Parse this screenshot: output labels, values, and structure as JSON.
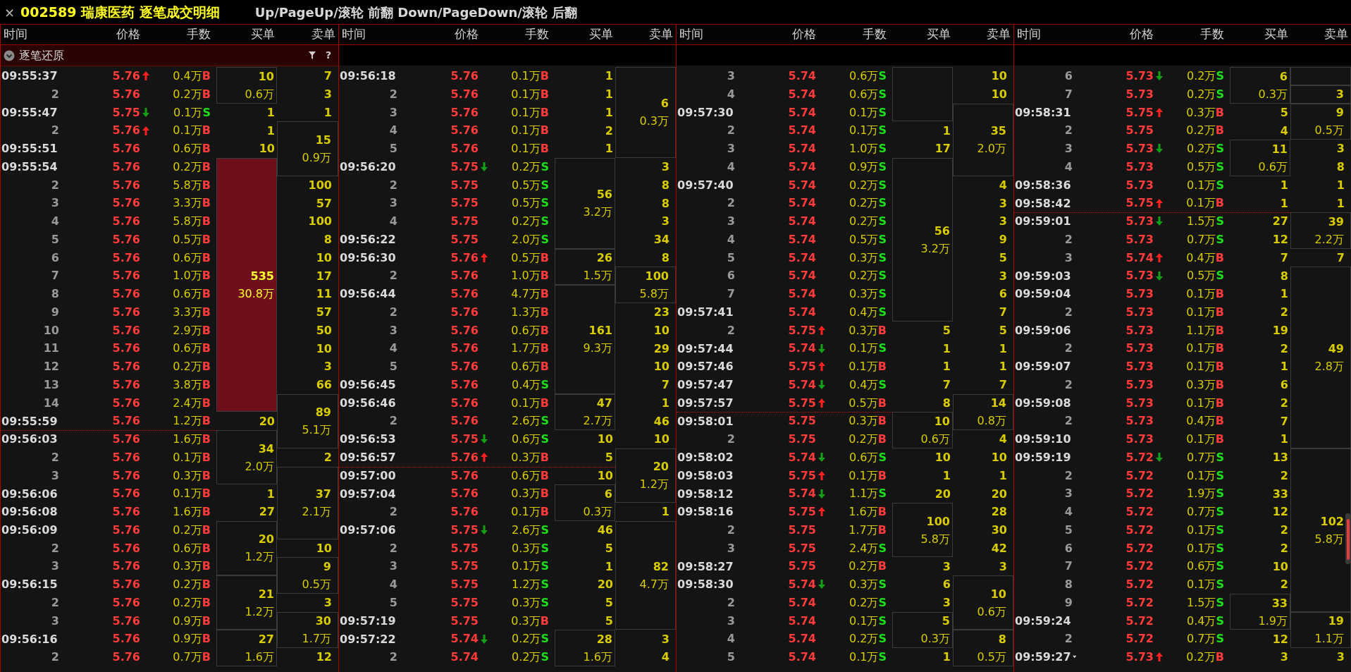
{
  "title": {
    "close": "×",
    "stock": "002589 瑞康医药 逐笔成交明细",
    "hint": "Up/PageUp/滚轮 前翻 Down/PageDown/滚轮 后翻"
  },
  "panels": [
    {
      "headers": [
        "时间",
        "价格",
        "手数",
        "买单",
        "卖单"
      ],
      "toolbar": {
        "label": "逐笔还原",
        "help": "?"
      },
      "rows": [
        {
          "time": "09:55:37",
          "price": "5.76",
          "uptick": true,
          "volume": "0.4万",
          "side": "B",
          "buyer": true,
          "buy": {
            "count": "10",
            "amount": "0.6万",
            "boxed": true
          },
          "sell": {
            "count": "7",
            "boxed": false
          }
        },
        {
          "seq": "2",
          "price": "5.76",
          "volume": "0.2万",
          "side": "B",
          "buyer": true,
          "sell": {
            "count": "3",
            "boxed": false
          }
        },
        {
          "time": "09:55:47",
          "price": "5.75",
          "downtick": true,
          "volume": "0.1万",
          "side": "S",
          "buyer": false,
          "buy": {
            "count": "1",
            "boxed": false
          },
          "sell": {
            "count": "1",
            "boxed": false
          }
        },
        {
          "seq": "2",
          "price": "5.76",
          "uptick": true,
          "volume": "0.1万",
          "side": "B",
          "buyer": true,
          "buy": {
            "count": "1",
            "boxed": false
          },
          "sell": {
            "count": "15",
            "amount": "0.9万",
            "boxed": true
          }
        },
        {
          "time": "09:55:51",
          "price": "5.76",
          "volume": "0.6万",
          "side": "B",
          "buyer": true,
          "buy": {
            "count": "10",
            "boxed": false
          }
        },
        {
          "time": "09:55:54",
          "price": "5.76",
          "volume": "0.2万",
          "side": "B",
          "buyer": true,
          "buy": {
            "count": "535",
            "amount": "30.8万",
            "boxed": true,
            "highlight": true
          }
        },
        {
          "seq": "2",
          "price": "5.76",
          "volume": "5.8万",
          "side": "B",
          "buyer": true,
          "sell": {
            "count": "100",
            "boxed": false
          }
        },
        {
          "seq": "3",
          "price": "5.76",
          "volume": "3.3万",
          "side": "B",
          "buyer": true,
          "sell": {
            "count": "57",
            "boxed": false
          }
        },
        {
          "seq": "4",
          "price": "5.76",
          "volume": "5.8万",
          "side": "B",
          "buyer": true,
          "sell": {
            "count": "100",
            "boxed": false
          }
        },
        {
          "seq": "5",
          "price": "5.76",
          "volume": "0.5万",
          "side": "B",
          "buyer": true,
          "sell": {
            "count": "8",
            "boxed": false
          }
        },
        {
          "seq": "6",
          "price": "5.76",
          "volume": "0.6万",
          "side": "B",
          "buyer": true,
          "sell": {
            "count": "10",
            "boxed": false
          }
        },
        {
          "seq": "7",
          "price": "5.76",
          "volume": "1.0万",
          "side": "B",
          "buyer": true,
          "sell": {
            "count": "17",
            "boxed": false
          }
        },
        {
          "seq": "8",
          "price": "5.76",
          "volume": "0.6万",
          "side": "B",
          "buyer": true,
          "sell": {
            "count": "11",
            "boxed": false
          }
        },
        {
          "seq": "9",
          "price": "5.76",
          "volume": "3.3万",
          "side": "B",
          "buyer": true,
          "sell": {
            "count": "57",
            "boxed": false
          }
        },
        {
          "seq": "10",
          "price": "5.76",
          "volume": "2.9万",
          "side": "B",
          "buyer": true,
          "sell": {
            "count": "50",
            "boxed": false
          }
        },
        {
          "seq": "11",
          "price": "5.76",
          "volume": "0.6万",
          "side": "B",
          "buyer": true,
          "sell": {
            "count": "10",
            "boxed": false
          }
        },
        {
          "seq": "12",
          "price": "5.76",
          "volume": "0.2万",
          "side": "B",
          "buyer": true,
          "sell": {
            "count": "3",
            "boxed": false
          }
        },
        {
          "seq": "13",
          "price": "5.76",
          "volume": "3.8万",
          "side": "B",
          "buyer": true,
          "sell": {
            "count": "66",
            "boxed": false
          }
        },
        {
          "seq": "14",
          "price": "5.76",
          "volume": "2.4万",
          "side": "B",
          "buyer": true,
          "sell": {
            "count": "89",
            "amount": "5.1万",
            "boxed": true
          }
        },
        {
          "time": "09:55:59",
          "price": "5.76",
          "volume": "1.2万",
          "side": "B",
          "buyer": true,
          "buy": {
            "count": "20",
            "boxed": false
          }
        },
        {
          "time": "09:56:03",
          "price": "5.76",
          "volume": "1.6万",
          "side": "B",
          "buyer": true,
          "divider_above": true,
          "buy": {
            "count": "34",
            "amount": "2.0万",
            "boxed": true
          }
        },
        {
          "seq": "2",
          "price": "5.76",
          "volume": "0.1万",
          "side": "B",
          "buyer": true,
          "sell": {
            "count": "2",
            "boxed": false
          }
        },
        {
          "seq": "3",
          "price": "5.76",
          "volume": "0.3万",
          "side": "B",
          "buyer": true,
          "sell": {
            "count": "37",
            "amount": "2.1万",
            "boxed": true
          }
        },
        {
          "time": "09:56:06",
          "price": "5.76",
          "volume": "0.1万",
          "side": "B",
          "buyer": true,
          "buy": {
            "count": "1",
            "boxed": false
          }
        },
        {
          "time": "09:56:08",
          "price": "5.76",
          "volume": "1.6万",
          "side": "B",
          "buyer": true,
          "buy": {
            "count": "27",
            "boxed": false
          }
        },
        {
          "time": "09:56:09",
          "price": "5.76",
          "volume": "0.2万",
          "side": "B",
          "buyer": true,
          "buy": {
            "count": "20",
            "amount": "1.2万",
            "boxed": true
          }
        },
        {
          "seq": "2",
          "price": "5.76",
          "volume": "0.6万",
          "side": "B",
          "buyer": true,
          "sell": {
            "count": "10",
            "boxed": false
          }
        },
        {
          "seq": "3",
          "price": "5.76",
          "volume": "0.3万",
          "side": "B",
          "buyer": true,
          "sell": {
            "count": "9",
            "amount": "0.5万",
            "boxed": true
          }
        },
        {
          "time": "09:56:15",
          "price": "5.76",
          "volume": "0.2万",
          "side": "B",
          "buyer": true,
          "buy": {
            "count": "21",
            "amount": "1.2万",
            "boxed": true
          }
        },
        {
          "seq": "2",
          "price": "5.76",
          "volume": "0.2万",
          "side": "B",
          "buyer": true,
          "sell": {
            "count": "3",
            "boxed": false
          }
        },
        {
          "seq": "3",
          "price": "5.76",
          "volume": "0.9万",
          "side": "B",
          "buyer": true,
          "sell": {
            "count": "30",
            "amount": "1.7万",
            "boxed": true
          }
        },
        {
          "time": "09:56:16",
          "price": "5.76",
          "volume": "0.9万",
          "side": "B",
          "buyer": true,
          "buy": {
            "count": "27",
            "amount": "1.6万",
            "boxed": true
          }
        },
        {
          "seq": "2",
          "price": "5.76",
          "volume": "0.7万",
          "side": "B",
          "buyer": true,
          "sell": {
            "count": "12",
            "boxed": false
          }
        }
      ]
    },
    {
      "headers": [
        "时间",
        "价格",
        "手数",
        "买单",
        "卖单"
      ],
      "rows": [
        {
          "time": "09:56:18",
          "price": "5.76",
          "volume": "0.1万",
          "side": "B",
          "buyer": true,
          "buy": {
            "count": "1",
            "boxed": false
          },
          "sell": {
            "count": "6",
            "amount": "0.3万",
            "boxed": true
          }
        },
        {
          "seq": "2",
          "price": "5.76",
          "volume": "0.1万",
          "side": "B",
          "buyer": true,
          "buy": {
            "count": "1",
            "boxed": false
          }
        },
        {
          "seq": "3",
          "price": "5.76",
          "volume": "0.1万",
          "side": "B",
          "buyer": true,
          "buy": {
            "count": "1",
            "boxed": false
          }
        },
        {
          "seq": "4",
          "price": "5.76",
          "volume": "0.1万",
          "side": "B",
          "buyer": true,
          "buy": {
            "count": "2",
            "boxed": false
          }
        },
        {
          "seq": "5",
          "price": "5.76",
          "volume": "0.1万",
          "side": "B",
          "buyer": true,
          "buy": {
            "count": "1",
            "boxed": false
          }
        },
        {
          "time": "09:56:20",
          "price": "5.75",
          "downtick": true,
          "volume": "0.2万",
          "side": "S",
          "buyer": false,
          "buy": {
            "count": "56",
            "amount": "3.2万",
            "boxed": true
          },
          "sell": {
            "count": "3",
            "boxed": false
          }
        },
        {
          "seq": "2",
          "price": "5.75",
          "volume": "0.5万",
          "side": "S",
          "buyer": false,
          "sell": {
            "count": "8",
            "boxed": false
          }
        },
        {
          "seq": "3",
          "price": "5.75",
          "volume": "0.5万",
          "side": "S",
          "buyer": false,
          "sell": {
            "count": "8",
            "boxed": false
          }
        },
        {
          "seq": "4",
          "price": "5.75",
          "volume": "0.2万",
          "side": "S",
          "buyer": false,
          "sell": {
            "count": "3",
            "boxed": false
          }
        },
        {
          "time": "09:56:22",
          "price": "5.75",
          "volume": "2.0万",
          "side": "S",
          "buyer": false,
          "sell": {
            "count": "34",
            "boxed": false
          }
        },
        {
          "time": "09:56:30",
          "price": "5.76",
          "uptick": true,
          "volume": "0.5万",
          "side": "B",
          "buyer": true,
          "buy": {
            "count": "26",
            "amount": "1.5万",
            "boxed": true
          },
          "sell": {
            "count": "8",
            "boxed": false
          }
        },
        {
          "seq": "2",
          "price": "5.76",
          "volume": "1.0万",
          "side": "B",
          "buyer": true,
          "sell": {
            "count": "100",
            "amount": "5.8万",
            "boxed": true
          }
        },
        {
          "time": "09:56:44",
          "price": "5.76",
          "volume": "4.7万",
          "side": "B",
          "buyer": true,
          "buy": {
            "count": "161",
            "amount": "9.3万",
            "boxed": true
          }
        },
        {
          "seq": "2",
          "price": "5.76",
          "volume": "1.3万",
          "side": "B",
          "buyer": true,
          "sell": {
            "count": "23",
            "boxed": false
          }
        },
        {
          "seq": "3",
          "price": "5.76",
          "volume": "0.6万",
          "side": "B",
          "buyer": true,
          "sell": {
            "count": "10",
            "boxed": false
          }
        },
        {
          "seq": "4",
          "price": "5.76",
          "volume": "1.7万",
          "side": "B",
          "buyer": true,
          "sell": {
            "count": "29",
            "boxed": false
          }
        },
        {
          "seq": "5",
          "price": "5.76",
          "volume": "0.6万",
          "side": "B",
          "buyer": true,
          "sell": {
            "count": "10",
            "boxed": false
          }
        },
        {
          "time": "09:56:45",
          "price": "5.76",
          "volume": "0.4万",
          "side": "S",
          "buyer": false,
          "sell": {
            "count": "7",
            "boxed": false
          }
        },
        {
          "time": "09:56:46",
          "price": "5.76",
          "volume": "0.1万",
          "side": "B",
          "buyer": true,
          "buy": {
            "count": "47",
            "amount": "2.7万",
            "boxed": true
          },
          "sell": {
            "count": "1",
            "boxed": false
          }
        },
        {
          "seq": "2",
          "price": "5.76",
          "volume": "2.6万",
          "side": "S",
          "buyer": false,
          "sell": {
            "count": "46",
            "boxed": false
          }
        },
        {
          "time": "09:56:53",
          "price": "5.75",
          "downtick": true,
          "volume": "0.6万",
          "side": "S",
          "buyer": false,
          "buy": {
            "count": "10",
            "boxed": false
          },
          "sell": {
            "count": "10",
            "boxed": false
          }
        },
        {
          "time": "09:56:57",
          "price": "5.76",
          "uptick": true,
          "volume": "0.3万",
          "side": "B",
          "buyer": true,
          "buy": {
            "count": "5",
            "boxed": false
          },
          "sell": {
            "count": "20",
            "amount": "1.2万",
            "boxed": true
          }
        },
        {
          "time": "09:57:00",
          "price": "5.76",
          "volume": "0.6万",
          "side": "B",
          "buyer": true,
          "divider_above": true,
          "buy": {
            "count": "10",
            "boxed": false
          }
        },
        {
          "time": "09:57:04",
          "price": "5.76",
          "volume": "0.3万",
          "side": "B",
          "buyer": true,
          "buy": {
            "count": "6",
            "amount": "0.3万",
            "boxed": true
          }
        },
        {
          "seq": "2",
          "price": "5.76",
          "volume": "0.1万",
          "side": "B",
          "buyer": true,
          "sell": {
            "count": "1",
            "boxed": false
          }
        },
        {
          "time": "09:57:06",
          "price": "5.75",
          "downtick": true,
          "volume": "2.6万",
          "side": "S",
          "buyer": false,
          "buy": {
            "count": "46",
            "boxed": false
          },
          "sell": {
            "count": "82",
            "amount": "4.7万",
            "boxed": true
          }
        },
        {
          "seq": "2",
          "price": "5.75",
          "volume": "0.3万",
          "side": "S",
          "buyer": false,
          "buy": {
            "count": "5",
            "boxed": false
          }
        },
        {
          "seq": "3",
          "price": "5.75",
          "volume": "0.1万",
          "side": "S",
          "buyer": false,
          "buy": {
            "count": "1",
            "boxed": false
          }
        },
        {
          "seq": "4",
          "price": "5.75",
          "volume": "1.2万",
          "side": "S",
          "buyer": false,
          "buy": {
            "count": "20",
            "boxed": false
          }
        },
        {
          "seq": "5",
          "price": "5.75",
          "volume": "0.3万",
          "side": "S",
          "buyer": false,
          "buy": {
            "count": "5",
            "boxed": false
          }
        },
        {
          "time": "09:57:19",
          "price": "5.75",
          "volume": "0.3万",
          "side": "B",
          "buyer": true,
          "buy": {
            "count": "5",
            "boxed": false
          }
        },
        {
          "time": "09:57:22",
          "price": "5.74",
          "downtick": true,
          "volume": "0.2万",
          "side": "S",
          "buyer": false,
          "buy": {
            "count": "28",
            "amount": "1.6万",
            "boxed": true
          },
          "sell": {
            "count": "3",
            "boxed": false
          }
        },
        {
          "seq": "2",
          "price": "5.74",
          "volume": "0.2万",
          "side": "S",
          "buyer": false,
          "sell": {
            "count": "4",
            "boxed": false
          }
        }
      ]
    },
    {
      "headers": [
        "时间",
        "价格",
        "手数",
        "买单",
        "卖单"
      ],
      "rows": [
        {
          "seq": "3",
          "price": "5.74",
          "volume": "0.6万",
          "side": "S",
          "buyer": false,
          "buy": {
            "boxed": true
          },
          "sell": {
            "count": "10",
            "boxed": false
          }
        },
        {
          "seq": "4",
          "price": "5.74",
          "volume": "0.6万",
          "side": "S",
          "buyer": false,
          "sell": {
            "count": "10",
            "boxed": false
          }
        },
        {
          "time": "09:57:30",
          "price": "5.74",
          "volume": "0.1万",
          "side": "S",
          "buyer": false,
          "sell": {
            "count": "35",
            "amount": "2.0万",
            "boxed": true
          }
        },
        {
          "seq": "2",
          "price": "5.74",
          "volume": "0.1万",
          "side": "S",
          "buyer": false,
          "buy": {
            "count": "1",
            "boxed": false
          }
        },
        {
          "seq": "3",
          "price": "5.74",
          "volume": "1.0万",
          "side": "S",
          "buyer": false,
          "buy": {
            "count": "17",
            "boxed": false
          }
        },
        {
          "seq": "4",
          "price": "5.74",
          "volume": "0.9万",
          "side": "S",
          "buyer": false,
          "buy": {
            "count": "56",
            "amount": "3.2万",
            "boxed": true
          }
        },
        {
          "time": "09:57:40",
          "price": "5.74",
          "volume": "0.2万",
          "side": "S",
          "buyer": false,
          "sell": {
            "count": "4",
            "boxed": false
          }
        },
        {
          "seq": "2",
          "price": "5.74",
          "volume": "0.2万",
          "side": "S",
          "buyer": false,
          "sell": {
            "count": "3",
            "boxed": false
          }
        },
        {
          "seq": "3",
          "price": "5.74",
          "volume": "0.2万",
          "side": "S",
          "buyer": false,
          "sell": {
            "count": "3",
            "boxed": false
          }
        },
        {
          "seq": "4",
          "price": "5.74",
          "volume": "0.5万",
          "side": "S",
          "buyer": false,
          "sell": {
            "count": "9",
            "boxed": false
          }
        },
        {
          "seq": "5",
          "price": "5.74",
          "volume": "0.3万",
          "side": "S",
          "buyer": false,
          "sell": {
            "count": "5",
            "boxed": false
          }
        },
        {
          "seq": "6",
          "price": "5.74",
          "volume": "0.2万",
          "side": "S",
          "buyer": false,
          "sell": {
            "count": "3",
            "boxed": false
          }
        },
        {
          "seq": "7",
          "price": "5.74",
          "volume": "0.3万",
          "side": "S",
          "buyer": false,
          "sell": {
            "count": "6",
            "boxed": false
          }
        },
        {
          "time": "09:57:41",
          "price": "5.74",
          "volume": "0.4万",
          "side": "S",
          "buyer": false,
          "sell": {
            "count": "7",
            "boxed": false
          }
        },
        {
          "seq": "2",
          "price": "5.75",
          "uptick": true,
          "volume": "0.3万",
          "side": "B",
          "buyer": true,
          "buy": {
            "count": "5",
            "boxed": false
          },
          "sell": {
            "count": "5",
            "boxed": false
          }
        },
        {
          "time": "09:57:44",
          "price": "5.74",
          "downtick": true,
          "volume": "0.1万",
          "side": "S",
          "buyer": false,
          "buy": {
            "count": "1",
            "boxed": false
          },
          "sell": {
            "count": "1",
            "boxed": false
          }
        },
        {
          "time": "09:57:46",
          "price": "5.75",
          "uptick": true,
          "volume": "0.1万",
          "side": "B",
          "buyer": true,
          "buy": {
            "count": "1",
            "boxed": false
          },
          "sell": {
            "count": "1",
            "boxed": false
          }
        },
        {
          "time": "09:57:47",
          "price": "5.74",
          "downtick": true,
          "volume": "0.4万",
          "side": "S",
          "buyer": false,
          "buy": {
            "count": "7",
            "boxed": false
          },
          "sell": {
            "count": "7",
            "boxed": false
          }
        },
        {
          "time": "09:57:57",
          "price": "5.75",
          "uptick": true,
          "volume": "0.5万",
          "side": "B",
          "buyer": true,
          "buy": {
            "count": "8",
            "boxed": false
          },
          "sell": {
            "count": "14",
            "amount": "0.8万",
            "boxed": true
          }
        },
        {
          "time": "09:58:01",
          "price": "5.75",
          "volume": "0.3万",
          "side": "B",
          "buyer": true,
          "divider_above": true,
          "buy": {
            "count": "10",
            "amount": "0.6万",
            "boxed": true
          }
        },
        {
          "seq": "2",
          "price": "5.75",
          "volume": "0.2万",
          "side": "B",
          "buyer": true,
          "sell": {
            "count": "4",
            "boxed": false
          }
        },
        {
          "time": "09:58:02",
          "price": "5.74",
          "downtick": true,
          "volume": "0.6万",
          "side": "S",
          "buyer": false,
          "buy": {
            "count": "10",
            "boxed": false
          },
          "sell": {
            "count": "10",
            "boxed": false
          }
        },
        {
          "time": "09:58:03",
          "price": "5.75",
          "uptick": true,
          "volume": "0.1万",
          "side": "B",
          "buyer": true,
          "buy": {
            "count": "1",
            "boxed": false
          },
          "sell": {
            "count": "1",
            "boxed": false
          }
        },
        {
          "time": "09:58:12",
          "price": "5.74",
          "downtick": true,
          "volume": "1.1万",
          "side": "S",
          "buyer": false,
          "buy": {
            "count": "20",
            "boxed": false
          },
          "sell": {
            "count": "20",
            "boxed": false
          }
        },
        {
          "time": "09:58:16",
          "price": "5.75",
          "uptick": true,
          "volume": "1.6万",
          "side": "B",
          "buyer": true,
          "buy": {
            "count": "100",
            "amount": "5.8万",
            "boxed": true
          },
          "sell": {
            "count": "28",
            "boxed": false
          }
        },
        {
          "seq": "2",
          "price": "5.75",
          "volume": "1.7万",
          "side": "B",
          "buyer": true,
          "sell": {
            "count": "30",
            "boxed": false
          }
        },
        {
          "seq": "3",
          "price": "5.75",
          "volume": "2.4万",
          "side": "S",
          "buyer": false,
          "sell": {
            "count": "42",
            "boxed": false
          }
        },
        {
          "time": "09:58:27",
          "price": "5.75",
          "volume": "0.2万",
          "side": "B",
          "buyer": true,
          "buy": {
            "count": "3",
            "boxed": false
          },
          "sell": {
            "count": "3",
            "boxed": false
          }
        },
        {
          "time": "09:58:30",
          "price": "5.74",
          "downtick": true,
          "volume": "0.3万",
          "side": "S",
          "buyer": false,
          "buy": {
            "count": "6",
            "boxed": false
          },
          "sell": {
            "count": "10",
            "amount": "0.6万",
            "boxed": true
          }
        },
        {
          "seq": "2",
          "price": "5.74",
          "volume": "0.2万",
          "side": "S",
          "buyer": false,
          "buy": {
            "count": "3",
            "boxed": false
          }
        },
        {
          "seq": "3",
          "price": "5.74",
          "volume": "0.1万",
          "side": "S",
          "buyer": false,
          "buy": {
            "count": "5",
            "amount": "0.3万",
            "boxed": true
          }
        },
        {
          "seq": "4",
          "price": "5.74",
          "volume": "0.2万",
          "side": "S",
          "buyer": false,
          "sell": {
            "count": "8",
            "amount": "0.5万",
            "boxed": true
          }
        },
        {
          "seq": "5",
          "price": "5.74",
          "volume": "0.1万",
          "side": "S",
          "buyer": false,
          "buy": {
            "count": "1",
            "boxed": false
          }
        }
      ]
    },
    {
      "headers": [
        "时间",
        "价格",
        "手数",
        "买单",
        "卖单"
      ],
      "rows": [
        {
          "seq": "6",
          "price": "5.73",
          "downtick": true,
          "volume": "0.2万",
          "side": "S",
          "buyer": false,
          "buy": {
            "count": "6",
            "amount": "0.3万",
            "boxed": true
          },
          "sell": {
            "boxed": true
          }
        },
        {
          "seq": "7",
          "price": "5.73",
          "volume": "0.2万",
          "side": "S",
          "buyer": false,
          "sell": {
            "count": "3",
            "boxed": true
          }
        },
        {
          "time": "09:58:31",
          "price": "5.75",
          "uptick": true,
          "volume": "0.3万",
          "side": "B",
          "buyer": true,
          "buy": {
            "count": "5",
            "boxed": false
          },
          "sell": {
            "count": "9",
            "amount": "0.5万",
            "boxed": true
          }
        },
        {
          "seq": "2",
          "price": "5.75",
          "volume": "0.2万",
          "side": "B",
          "buyer": true,
          "buy": {
            "count": "4",
            "boxed": false
          }
        },
        {
          "seq": "3",
          "price": "5.73",
          "downtick": true,
          "volume": "0.2万",
          "side": "S",
          "buyer": false,
          "buy": {
            "count": "11",
            "amount": "0.6万",
            "boxed": true
          },
          "sell": {
            "count": "3",
            "boxed": false
          }
        },
        {
          "seq": "4",
          "price": "5.73",
          "volume": "0.5万",
          "side": "S",
          "buyer": false,
          "sell": {
            "count": "8",
            "boxed": false
          }
        },
        {
          "time": "09:58:36",
          "price": "5.73",
          "volume": "0.1万",
          "side": "S",
          "buyer": false,
          "buy": {
            "count": "1",
            "boxed": false
          },
          "sell": {
            "count": "1",
            "boxed": false
          }
        },
        {
          "time": "09:58:42",
          "price": "5.75",
          "uptick": true,
          "volume": "0.1万",
          "side": "B",
          "buyer": true,
          "buy": {
            "count": "1",
            "boxed": false
          },
          "sell": {
            "count": "1",
            "boxed": false
          }
        },
        {
          "time": "09:59:01",
          "price": "5.73",
          "downtick": true,
          "volume": "1.5万",
          "side": "S",
          "buyer": false,
          "divider_above": true,
          "buy": {
            "count": "27",
            "boxed": false
          },
          "sell": {
            "count": "39",
            "amount": "2.2万",
            "boxed": true
          }
        },
        {
          "seq": "2",
          "price": "5.73",
          "volume": "0.7万",
          "side": "S",
          "buyer": false,
          "buy": {
            "count": "12",
            "boxed": false
          }
        },
        {
          "seq": "3",
          "price": "5.74",
          "uptick": true,
          "volume": "0.4万",
          "side": "B",
          "buyer": true,
          "buy": {
            "count": "7",
            "boxed": false
          },
          "sell": {
            "count": "7",
            "boxed": false
          }
        },
        {
          "time": "09:59:03",
          "price": "5.73",
          "downtick": true,
          "volume": "0.5万",
          "side": "S",
          "buyer": false,
          "buy": {
            "count": "8",
            "boxed": false
          },
          "sell": {
            "count": "49",
            "amount": "2.8万",
            "boxed": true
          }
        },
        {
          "time": "09:59:04",
          "price": "5.73",
          "volume": "0.1万",
          "side": "B",
          "buyer": true,
          "buy": {
            "count": "1",
            "boxed": false
          }
        },
        {
          "seq": "2",
          "price": "5.73",
          "volume": "0.1万",
          "side": "B",
          "buyer": true,
          "buy": {
            "count": "2",
            "boxed": false
          }
        },
        {
          "time": "09:59:06",
          "price": "5.73",
          "volume": "1.1万",
          "side": "B",
          "buyer": true,
          "buy": {
            "count": "19",
            "boxed": false
          }
        },
        {
          "seq": "2",
          "price": "5.73",
          "volume": "0.1万",
          "side": "B",
          "buyer": true,
          "buy": {
            "count": "2",
            "boxed": false
          }
        },
        {
          "time": "09:59:07",
          "price": "5.73",
          "volume": "0.1万",
          "side": "B",
          "buyer": true,
          "buy": {
            "count": "1",
            "boxed": false
          }
        },
        {
          "seq": "2",
          "price": "5.73",
          "volume": "0.3万",
          "side": "B",
          "buyer": true,
          "buy": {
            "count": "6",
            "boxed": false
          }
        },
        {
          "time": "09:59:08",
          "price": "5.73",
          "volume": "0.1万",
          "side": "B",
          "buyer": true,
          "buy": {
            "count": "2",
            "boxed": false
          }
        },
        {
          "seq": "2",
          "price": "5.73",
          "volume": "0.4万",
          "side": "B",
          "buyer": true,
          "buy": {
            "count": "7",
            "boxed": false
          }
        },
        {
          "time": "09:59:10",
          "price": "5.73",
          "volume": "0.1万",
          "side": "B",
          "buyer": true,
          "buy": {
            "count": "1",
            "boxed": false
          }
        },
        {
          "time": "09:59:19",
          "price": "5.72",
          "downtick": true,
          "volume": "0.7万",
          "side": "S",
          "buyer": false,
          "buy": {
            "count": "13",
            "boxed": false
          },
          "sell": {
            "count": "102",
            "amount": "5.8万",
            "boxed": true
          }
        },
        {
          "seq": "2",
          "price": "5.72",
          "volume": "0.1万",
          "side": "S",
          "buyer": false,
          "buy": {
            "count": "2",
            "boxed": false
          }
        },
        {
          "seq": "3",
          "price": "5.72",
          "volume": "1.9万",
          "side": "S",
          "buyer": false,
          "buy": {
            "count": "33",
            "boxed": false
          }
        },
        {
          "seq": "4",
          "price": "5.72",
          "volume": "0.7万",
          "side": "S",
          "buyer": false,
          "buy": {
            "count": "12",
            "boxed": false
          }
        },
        {
          "seq": "5",
          "price": "5.72",
          "volume": "0.1万",
          "side": "S",
          "buyer": false,
          "buy": {
            "count": "2",
            "boxed": false
          }
        },
        {
          "seq": "6",
          "price": "5.72",
          "volume": "0.1万",
          "side": "S",
          "buyer": false,
          "buy": {
            "count": "2",
            "boxed": false
          }
        },
        {
          "seq": "7",
          "price": "5.72",
          "volume": "0.6万",
          "side": "S",
          "buyer": false,
          "buy": {
            "count": "10",
            "boxed": false
          }
        },
        {
          "seq": "8",
          "price": "5.72",
          "volume": "0.1万",
          "side": "S",
          "buyer": false,
          "buy": {
            "count": "2",
            "boxed": false
          }
        },
        {
          "seq": "9",
          "price": "5.72",
          "volume": "1.5万",
          "side": "S",
          "buyer": false,
          "buy": {
            "count": "33",
            "amount": "1.9万",
            "boxed": true
          }
        },
        {
          "time": "09:59:24",
          "price": "5.72",
          "volume": "0.4万",
          "side": "S",
          "buyer": false,
          "sell": {
            "count": "19",
            "amount": "1.1万",
            "boxed": true
          }
        },
        {
          "seq": "2",
          "price": "5.72",
          "volume": "0.7万",
          "side": "S",
          "buyer": false,
          "buy": {
            "count": "12",
            "boxed": false
          }
        },
        {
          "time": "09:59:27",
          "cursor": true,
          "price": "5.73",
          "uptick": true,
          "volume": "0.2万",
          "side": "B",
          "buyer": true,
          "buy": {
            "count": "3",
            "boxed": false
          },
          "sell": {
            "count": "3",
            "boxed": false
          }
        }
      ]
    }
  ]
}
